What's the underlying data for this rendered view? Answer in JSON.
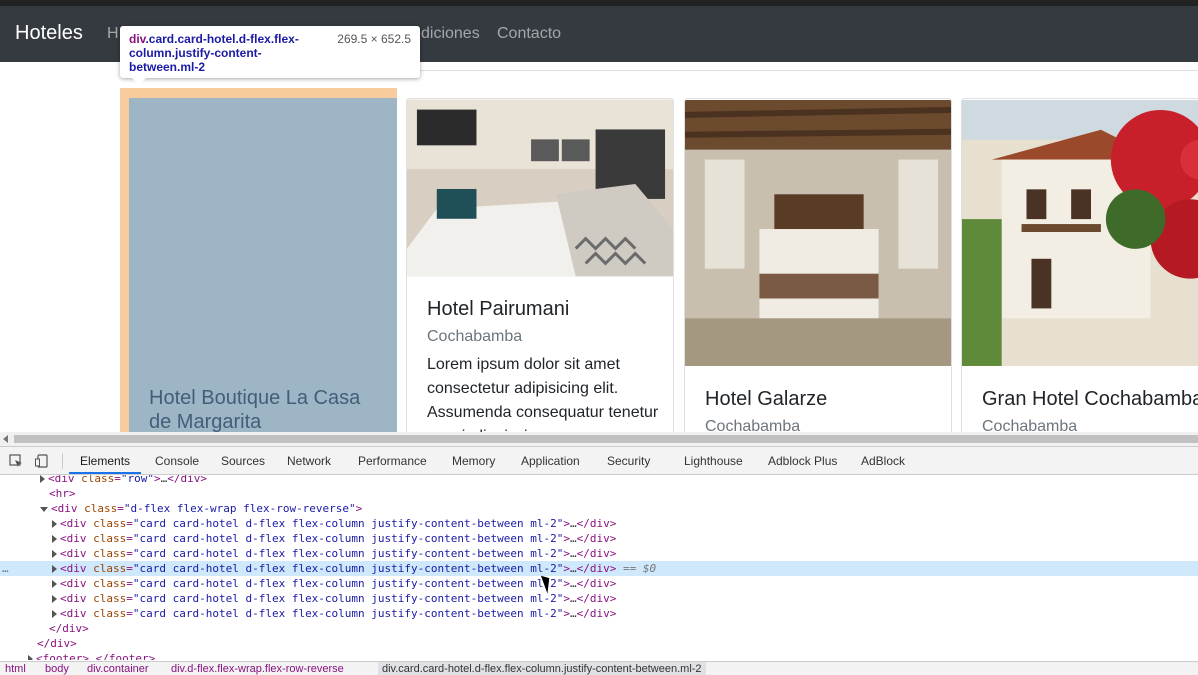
{
  "navbar": {
    "brand": "Hoteles",
    "links": [
      "H",
      "diciones",
      "Contacto"
    ]
  },
  "cards": [
    {
      "title": "Hotel Boutique La Casa de Margarita",
      "city": "",
      "text": ""
    },
    {
      "title": "Hotel Pairumani",
      "city": "Cochabamba",
      "text": "Lorem ipsum dolor sit amet consectetur adipisicing elit. Assumenda consequatur tenetur quasi, dignissimos"
    },
    {
      "title": "Hotel Galarze",
      "city": "Cochabamba",
      "text": ""
    },
    {
      "title": "Gran Hotel Cochabamba",
      "city": "Cochabamba",
      "text": ""
    }
  ],
  "tooltip": {
    "tag": "div",
    "classes": ".card.card-hotel.d-flex.flex-column.justify-content-between.ml-2",
    "dimensions": "269.5 × 652.5"
  },
  "devtools": {
    "tabs": [
      "Elements",
      "Console",
      "Sources",
      "Network",
      "Performance",
      "Memory",
      "Application",
      "Security",
      "Lighthouse",
      "Adblock Plus",
      "AdBlock"
    ],
    "active_tab": "Elements",
    "dom": {
      "row_div": "div",
      "row_class": "row",
      "hr": "hr",
      "container_class": "d-flex flex-wrap flex-row-reverse",
      "card_class": "card card-hotel d-flex flex-column justify-content-between ml-2",
      "selected_marker": "== $0",
      "footer": "footer"
    },
    "breadcrumbs": [
      "html",
      "body",
      "div.container",
      "div.d-flex.flex-wrap.flex-row-reverse",
      "div.card.card-hotel.d-flex.flex-column.justify-content-between.ml-2"
    ]
  },
  "colors": {
    "navbar": "#343a40",
    "highlight_margin": "#f9cc9d",
    "highlight_content": "#6fa8dc",
    "selected_row": "#cfe8fc"
  }
}
